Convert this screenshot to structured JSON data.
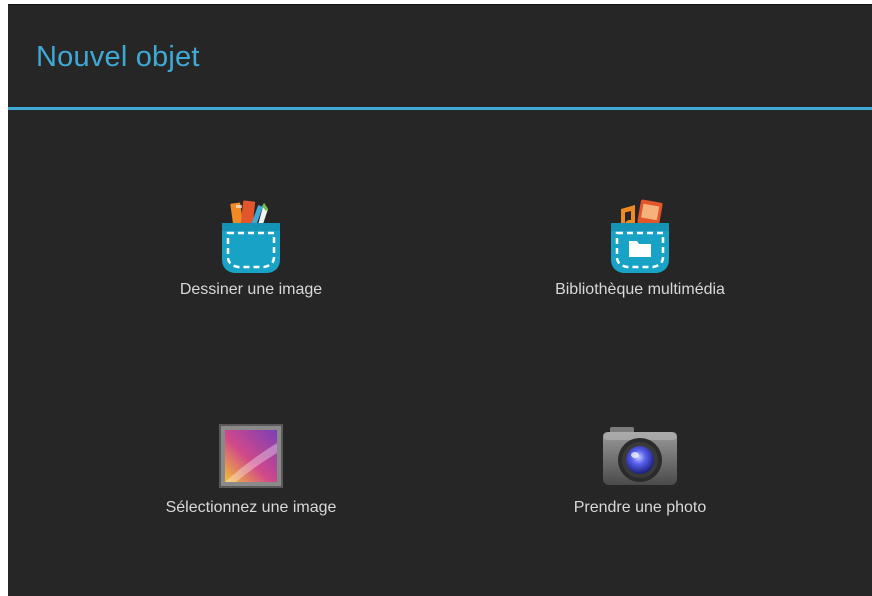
{
  "dialog": {
    "title": "Nouvel objet"
  },
  "options": [
    {
      "label": "Dessiner une image",
      "icon": "pocket-paint-icon"
    },
    {
      "label": "Bibliothèque multimédia",
      "icon": "pocket-media-library-icon"
    },
    {
      "label": "Sélectionnez une image",
      "icon": "gallery-image-icon"
    },
    {
      "label": "Prendre une photo",
      "icon": "camera-icon"
    }
  ],
  "colors": {
    "accent": "#3fa9d6",
    "background": "#262626",
    "label_text": "#d8d8d8"
  }
}
